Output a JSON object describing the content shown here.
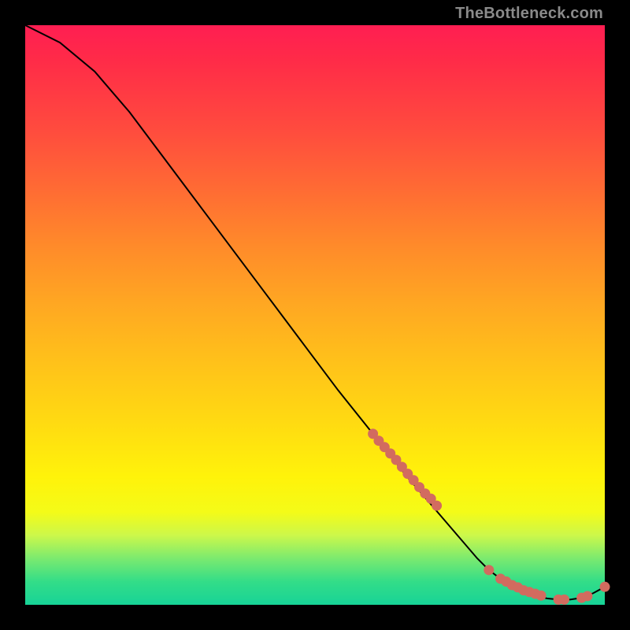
{
  "watermark": "TheBottleneck.com",
  "chart_data": {
    "type": "line",
    "title": "",
    "xlabel": "",
    "ylabel": "",
    "xlim": [
      0,
      100
    ],
    "ylim": [
      0,
      100
    ],
    "grid": false,
    "curve": {
      "name": "bottleneck-curve",
      "x": [
        0,
        6,
        12,
        18,
        24,
        30,
        36,
        42,
        48,
        54,
        60,
        66,
        72,
        78,
        80,
        82,
        84,
        86,
        88,
        90,
        92,
        94,
        96,
        98,
        100
      ],
      "y": [
        100,
        97,
        92,
        85,
        77,
        69,
        61,
        53,
        45,
        37,
        29.5,
        22,
        15,
        8,
        6,
        4.5,
        3.2,
        2.3,
        1.6,
        1.1,
        0.9,
        0.9,
        1.2,
        2.0,
        3.1
      ]
    },
    "points": {
      "name": "markers",
      "color": "#d26b5f",
      "x": [
        60,
        61,
        62,
        63,
        64,
        65,
        66,
        67,
        68,
        69,
        70,
        71,
        80,
        82,
        83,
        84,
        85,
        86,
        87,
        88,
        89,
        92,
        93,
        96,
        97,
        100
      ],
      "y": [
        29.5,
        28.3,
        27.2,
        26.1,
        25.0,
        23.8,
        22.6,
        21.5,
        20.3,
        19.2,
        18.3,
        17.1,
        6.0,
        4.5,
        4.0,
        3.4,
        3.0,
        2.5,
        2.2,
        1.9,
        1.6,
        0.9,
        0.9,
        1.2,
        1.5,
        3.1
      ]
    }
  }
}
